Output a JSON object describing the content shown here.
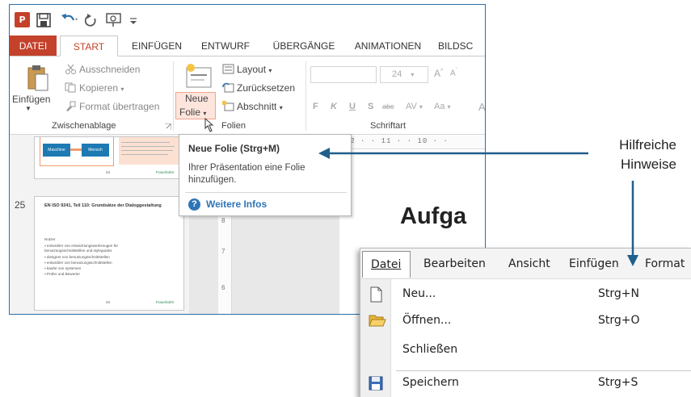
{
  "window": {
    "app_badge": "P"
  },
  "ribbon": {
    "tabs": [
      "DATEI",
      "START",
      "EINFÜGEN",
      "ENTWURF",
      "ÜBERGÄNGE",
      "ANIMATIONEN",
      "BILDSC"
    ],
    "active_tab": "START",
    "clipboard": {
      "paste": "Einfügen",
      "cut": "Ausschneiden",
      "copy": "Kopieren",
      "format_painter": "Format übertragen",
      "group_label": "Zwischenablage"
    },
    "slides": {
      "new_slide_line1": "Neue",
      "new_slide_line2": "Folie",
      "layout": "Layout",
      "reset": "Zurücksetzen",
      "section": "Abschnitt",
      "group_label": "Folien"
    },
    "font": {
      "size": "24",
      "grow": "A",
      "shrink": "A",
      "bold": "F",
      "italic": "K",
      "underline": "U",
      "shadow": "S",
      "strikethrough": "abc",
      "spacing": "AV",
      "change_case": "Aa",
      "font_color": "A",
      "group_label": "Schriftart"
    }
  },
  "tooltip": {
    "title": "Neue Folie (Strg+M)",
    "body": "Ihrer Präsentation eine Folie hinzufügen.",
    "link": "Weitere Infos",
    "help_glyph": "?"
  },
  "thumbnails": {
    "slide24": {
      "number": "24",
      "box1": "Maschine",
      "box2": "Mensch",
      "brand": "Fraunhofer"
    },
    "slide25": {
      "number": "25",
      "title": "EN ISO 9241, Teil 110: Grundsätze der Dialoggestaltung",
      "lead": "Nutzer",
      "bullets": [
        "entwickler von entwicklungswerkzeugen für benutzungsschnittstellen und styleguides",
        "designer von benutzungsschnittstellen",
        "entwickler von benutzungsschnittstellen",
        "käufer von systemen",
        "Prüfer und Bewerter"
      ],
      "footer_number": "24",
      "brand": "Fraunhofer"
    }
  },
  "rulers": {
    "horizontal": "· 12 · · 11 · · 10 · ·",
    "vertical_marks": [
      "8",
      "7",
      "6"
    ]
  },
  "slide": {
    "title": "Aufga"
  },
  "callout": {
    "line1": "Hilfreiche",
    "line2": "Hinweise",
    "arrow_color": "#1f5f8b"
  },
  "classic_menu": {
    "bar": [
      "Datei",
      "Bearbeiten",
      "Ansicht",
      "Einfügen",
      "Format"
    ],
    "items": [
      {
        "label": "Neu...",
        "shortcut": "Strg+N",
        "icon": "new-document-icon"
      },
      {
        "label": "Öffnen...",
        "shortcut": "Strg+O",
        "icon": "open-folder-icon"
      },
      {
        "label": "Schließen",
        "shortcut": "",
        "icon": ""
      },
      {
        "label": "Speichern",
        "shortcut": "Strg+S",
        "icon": "save-disk-icon"
      }
    ]
  },
  "colors": {
    "accent": "#c4412b",
    "window_border": "#2b6ea8",
    "link_blue": "#2e75b6"
  }
}
